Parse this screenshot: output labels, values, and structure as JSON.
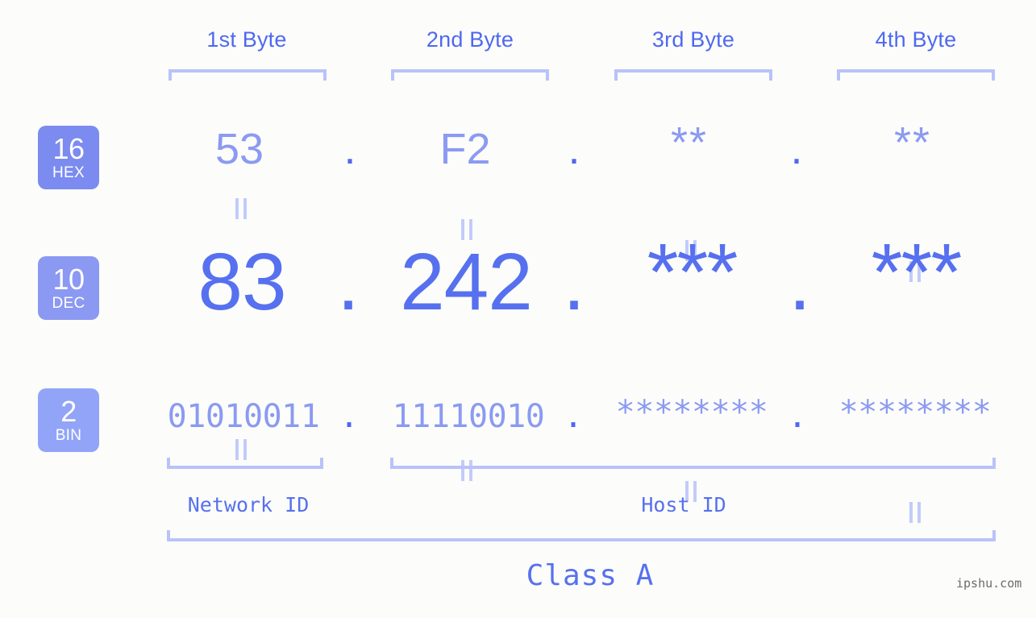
{
  "background_color": "#fcfdfa",
  "accent_color": "#5770ef",
  "muted_accent_color": "#8b9af2",
  "bracket_color": "#b9c2fa",
  "byte_headers": [
    {
      "label": "1st Byte"
    },
    {
      "label": "2nd Byte"
    },
    {
      "label": "3rd Byte"
    },
    {
      "label": "4th Byte"
    }
  ],
  "rows": [
    {
      "badge_number": "16",
      "badge_abbr": "HEX",
      "badge_color": "#7b8bf0",
      "values": [
        "53",
        "F2",
        "**",
        "**"
      ],
      "separator": "."
    },
    {
      "badge_number": "10",
      "badge_abbr": "DEC",
      "badge_color": "#8b99f2",
      "values": [
        "83",
        "242",
        "***",
        "***"
      ],
      "separator": "."
    },
    {
      "badge_number": "2",
      "badge_abbr": "BIN",
      "badge_color": "#92a4f7",
      "values": [
        "01010011",
        "11110010",
        "********",
        "********"
      ],
      "separator": "."
    }
  ],
  "connector_symbol": "=",
  "footer": {
    "network_id_label": "Network ID",
    "host_id_label": "Host ID",
    "class_label": "Class A",
    "watermark": "ipshu.com"
  }
}
